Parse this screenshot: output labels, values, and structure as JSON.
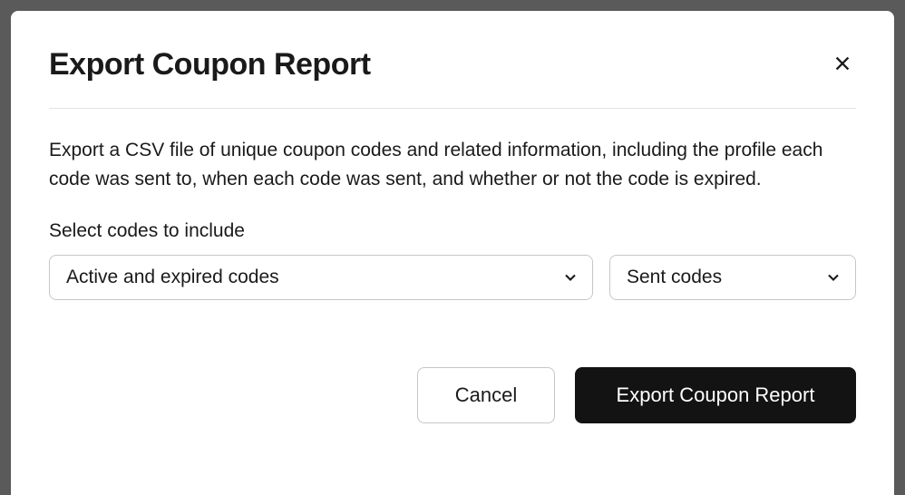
{
  "modal": {
    "title": "Export Coupon Report",
    "description": "Export a CSV file of unique coupon codes and related information, including the profile each code was sent to, when each code was sent, and whether or not the code is expired.",
    "selectLabel": "Select codes to include",
    "select1": {
      "value": "Active and expired codes"
    },
    "select2": {
      "value": "Sent codes"
    },
    "cancelLabel": "Cancel",
    "exportLabel": "Export Coupon Report"
  }
}
